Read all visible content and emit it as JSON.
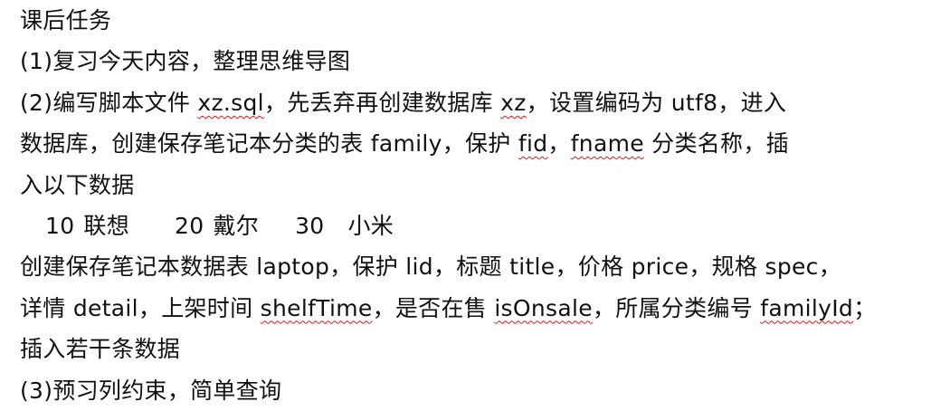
{
  "doc": {
    "title": "课后任务",
    "item1": "(1)复习今天内容，整理思维导图",
    "item2": {
      "l1_a": "(2)编写脚本文件 ",
      "l1_file": "xz.sql",
      "l1_b": "，先丢弃再创建数据库 ",
      "l1_db": "xz",
      "l1_c": "，设置编码为 utf8，进入",
      "l2_a": "数据库，创建保存笔记本分类的表 family，保护 ",
      "l2_fid": "fid",
      "l2_b": "，",
      "l2_fname": "fname",
      "l2_c": " 分类名称，插",
      "l3": "入以下数据"
    },
    "data_rows": [
      {
        "id": "10",
        "name": "联想"
      },
      {
        "id": "20",
        "name": "戴尔"
      },
      {
        "id": "30",
        "name": "小米"
      }
    ],
    "laptop": {
      "l1": "创建保存笔记本数据表 laptop，保护 lid，标题 title，价格 price，规格 spec，",
      "l2_a": "详情 detail，上架时间 ",
      "l2_shelf": "shelfTime",
      "l2_b": "，是否在售 ",
      "l2_sale": "isOnsale",
      "l2_c": "，所属分类编号 ",
      "l2_family": "familyId",
      "l2_d": "；",
      "l3": "插入若干条数据"
    },
    "item3": "(3)预习列约束，简单查询"
  }
}
